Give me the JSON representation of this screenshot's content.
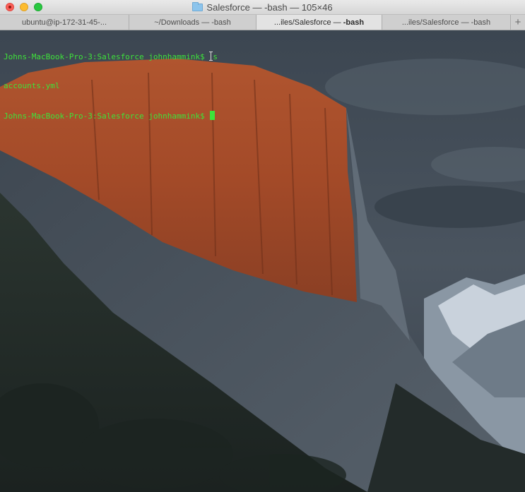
{
  "window": {
    "title": "Salesforce — -bash — 105×46",
    "title_icon": "folder-icon"
  },
  "tabs": [
    {
      "label": "ubuntu@ip-172-31-45-...",
      "active": false
    },
    {
      "label": "~/Downloads — -bash",
      "active": false
    },
    {
      "label_prefix": "...iles/Salesforce — ",
      "label_strong": "-bash",
      "active": true
    },
    {
      "label": "...iles/Salesforce — -bash",
      "active": false
    }
  ],
  "new_tab_label": "+",
  "terminal": {
    "prompt": "Johns-MacBook-Pro-3:Salesforce johnhammink$ ",
    "command_before_cursor": "l",
    "command_after_cursor": "s",
    "output": "accounts.yml",
    "prompt2": "Johns-MacBook-Pro-3:Salesforce johnhammink$ ",
    "text_color": "#3ee23a"
  },
  "colors": {
    "close": "#fc5f57",
    "minimize": "#fdbc2e",
    "maximize": "#28c840"
  }
}
